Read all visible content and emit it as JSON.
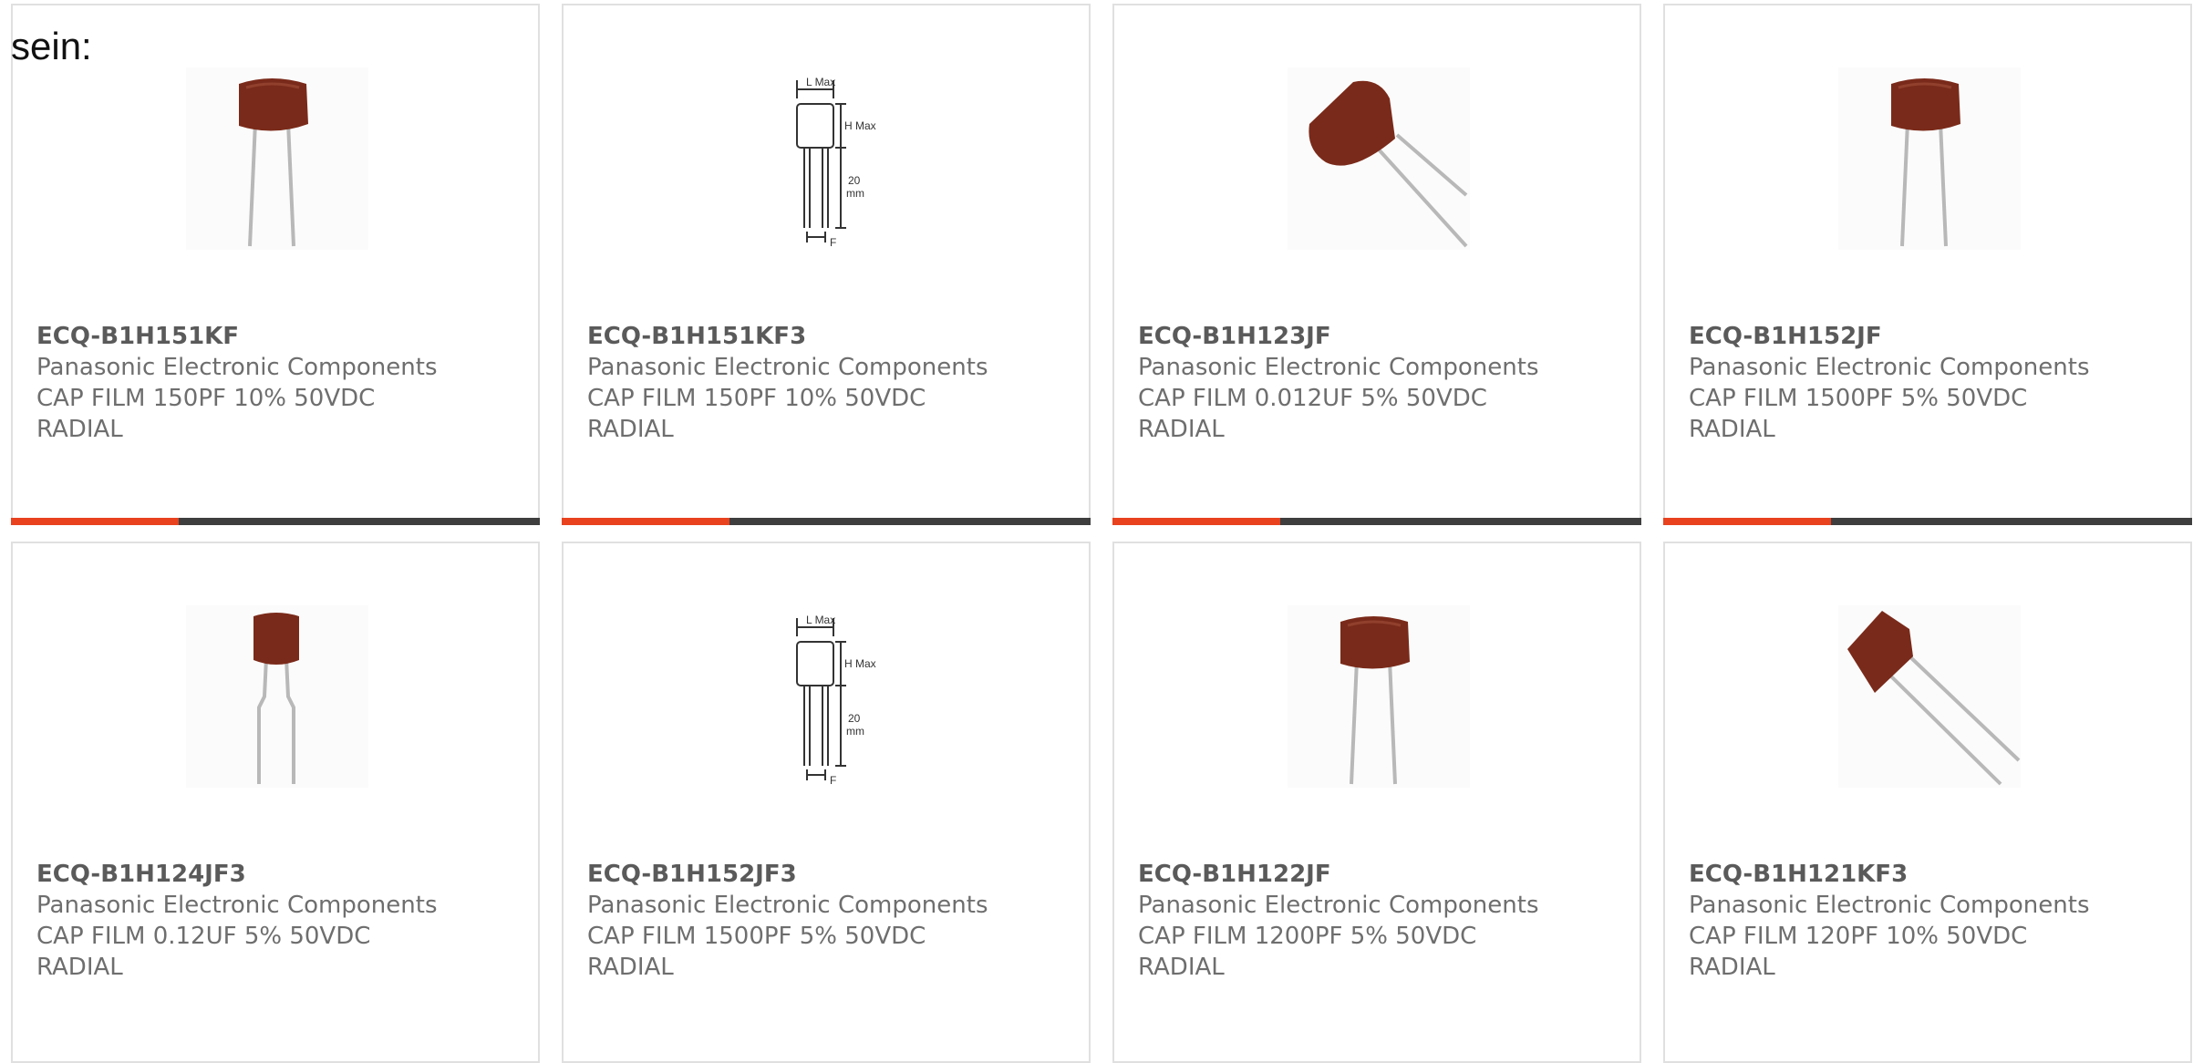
{
  "intro_text": "sein:",
  "colors": {
    "accent": "#e8421f",
    "bar_dark": "#3e3e3e",
    "capacitor_body": "#7a2a1a",
    "lead": "#b8b8b8"
  },
  "products": [
    {
      "part_number": "ECQ-B1H151KF",
      "manufacturer": "Panasonic Electronic Components",
      "description_line1": "CAP FILM 150PF 10% 50VDC",
      "description_line2": "RADIAL",
      "image": "capacitor-straight",
      "show_bar": true
    },
    {
      "part_number": "ECQ-B1H151KF3",
      "manufacturer": "Panasonic Electronic Components",
      "description_line1": "CAP FILM 150PF 10% 50VDC",
      "description_line2": "RADIAL",
      "image": "dimension-drawing",
      "drawing_labels": {
        "top": "L Max",
        "side": "H Max",
        "lead_top": "20",
        "lead_bottom": "mm",
        "bottom": "F"
      },
      "show_bar": true
    },
    {
      "part_number": "ECQ-B1H123JF",
      "manufacturer": "Panasonic Electronic Components",
      "description_line1": "CAP FILM 0.012UF 5% 50VDC",
      "description_line2": "RADIAL",
      "image": "capacitor-tilted",
      "show_bar": true
    },
    {
      "part_number": "ECQ-B1H152JF",
      "manufacturer": "Panasonic Electronic Components",
      "description_line1": "CAP FILM 1500PF 5% 50VDC",
      "description_line2": "RADIAL",
      "image": "capacitor-straight",
      "show_bar": true
    },
    {
      "part_number": "ECQ-B1H124JF3",
      "manufacturer": "Panasonic Electronic Components",
      "description_line1": "CAP FILM 0.12UF 5% 50VDC",
      "description_line2": "RADIAL",
      "image": "capacitor-kinked",
      "show_bar": false
    },
    {
      "part_number": "ECQ-B1H152JF3",
      "manufacturer": "Panasonic Electronic Components",
      "description_line1": "CAP FILM 1500PF 5% 50VDC",
      "description_line2": "RADIAL",
      "image": "dimension-drawing",
      "drawing_labels": {
        "top": "L Max",
        "side": "H Max",
        "lead_top": "20",
        "lead_bottom": "mm",
        "bottom": "F"
      },
      "show_bar": false
    },
    {
      "part_number": "ECQ-B1H122JF",
      "manufacturer": "Panasonic Electronic Components",
      "description_line1": "CAP FILM 1200PF 5% 50VDC",
      "description_line2": "RADIAL",
      "image": "capacitor-straight",
      "show_bar": false
    },
    {
      "part_number": "ECQ-B1H121KF3",
      "manufacturer": "Panasonic Electronic Components",
      "description_line1": "CAP FILM 120PF 10% 50VDC",
      "description_line2": "RADIAL",
      "image": "capacitor-diagonal",
      "show_bar": false
    }
  ]
}
